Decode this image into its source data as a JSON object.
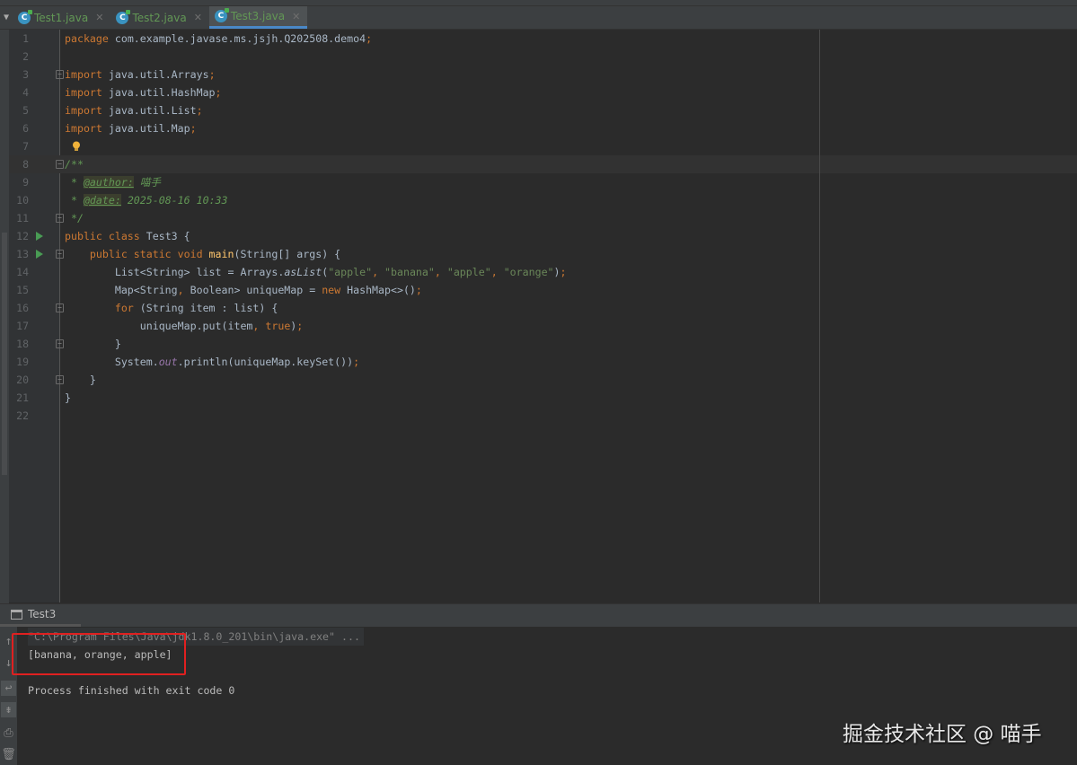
{
  "tabs": [
    {
      "label": "Test1.java",
      "active": false
    },
    {
      "label": "Test2.java",
      "active": false
    },
    {
      "label": "Test3.java",
      "active": true
    }
  ],
  "editor": {
    "lines": [
      [
        [
          "package",
          "kw"
        ],
        [
          " com.example.javase.ms.jsjh.Q202508.demo4",
          ""
        ],
        [
          ";",
          "kw"
        ]
      ],
      [],
      [
        [
          "import",
          "kw"
        ],
        [
          " java.util.Arrays",
          ""
        ],
        [
          ";",
          "kw"
        ]
      ],
      [
        [
          "import",
          "kw"
        ],
        [
          " java.util.HashMap",
          ""
        ],
        [
          ";",
          "kw"
        ]
      ],
      [
        [
          "import",
          "kw"
        ],
        [
          " java.util.List",
          ""
        ],
        [
          ";",
          "kw"
        ]
      ],
      [
        [
          "import",
          "kw"
        ],
        [
          " java.util.Map",
          ""
        ],
        [
          ";",
          "kw"
        ]
      ],
      [],
      [
        [
          "/**",
          "doc"
        ]
      ],
      [
        [
          " * ",
          "doc"
        ],
        [
          "@author:",
          "tag"
        ],
        [
          " 喵手",
          "doc"
        ]
      ],
      [
        [
          " * ",
          "doc"
        ],
        [
          "@date:",
          "tag"
        ],
        [
          " 2025-08-16 10:33",
          "doc"
        ]
      ],
      [
        [
          " */",
          "doc"
        ]
      ],
      [
        [
          "public class ",
          "kw"
        ],
        [
          "Test3 {",
          ""
        ]
      ],
      [
        [
          "    public static void ",
          "kw"
        ],
        [
          "main",
          "fn"
        ],
        [
          "(String[] args) {",
          ""
        ]
      ],
      [
        [
          "        List<String> list = Arrays.",
          ""
        ],
        [
          "asList",
          "st"
        ],
        [
          "(",
          ""
        ],
        [
          "\"apple\"",
          "str"
        ],
        [
          ", ",
          "kw"
        ],
        [
          "\"banana\"",
          "str"
        ],
        [
          ", ",
          "kw"
        ],
        [
          "\"apple\"",
          "str"
        ],
        [
          ", ",
          "kw"
        ],
        [
          "\"orange\"",
          "str"
        ],
        [
          ")",
          ""
        ],
        [
          ";",
          "kw"
        ]
      ],
      [
        [
          "        Map<String",
          ""
        ],
        [
          ", ",
          "kw"
        ],
        [
          "Boolean> uniqueMap = ",
          ""
        ],
        [
          "new ",
          "kw"
        ],
        [
          "HashMap<>()",
          ""
        ],
        [
          ";",
          "kw"
        ]
      ],
      [
        [
          "        ",
          ""
        ],
        [
          "for ",
          "kw"
        ],
        [
          "(String item : list) {",
          ""
        ]
      ],
      [
        [
          "            uniqueMap.put(item",
          ""
        ],
        [
          ", ",
          "kw"
        ],
        [
          "true",
          "kw"
        ],
        [
          ")",
          ""
        ],
        [
          ";",
          "kw"
        ]
      ],
      [
        [
          "        }",
          ""
        ]
      ],
      [
        [
          "        System.",
          ""
        ],
        [
          "out",
          "fld"
        ],
        [
          ".println(uniqueMap.keySet())",
          ""
        ],
        [
          ";",
          "kw"
        ]
      ],
      [
        [
          "    }",
          ""
        ]
      ],
      [
        [
          "}",
          ""
        ]
      ],
      []
    ],
    "run_lines": [
      12,
      13
    ],
    "fold_lines": [
      3,
      8,
      11,
      13,
      16,
      18,
      20
    ],
    "current_line": 8
  },
  "console": {
    "tab_label": "Test3",
    "lines": [
      "\"C:\\Program Files\\Java\\jdk1.8.0_201\\bin\\java.exe\" ...",
      "[banana, orange, apple]",
      "",
      "Process finished with exit code 0"
    ]
  },
  "watermark": "掘金技术社区 @ 喵手"
}
